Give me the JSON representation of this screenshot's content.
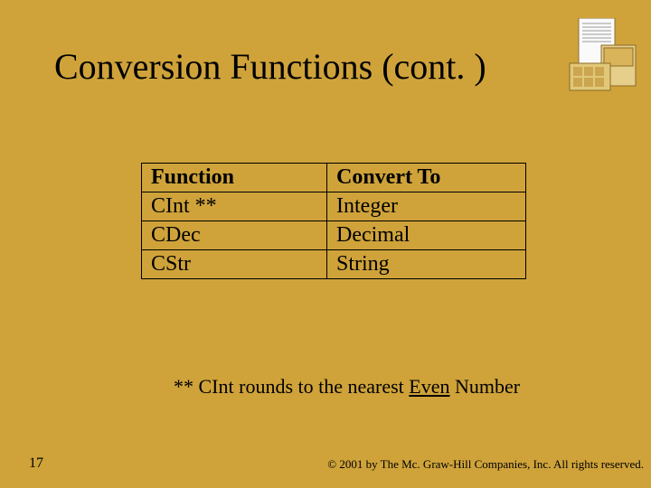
{
  "title": "Conversion Functions (cont. )",
  "table": {
    "headers": {
      "c1": "Function",
      "c2": "Convert To"
    },
    "rows": [
      {
        "c1": "CInt **",
        "c2": "Integer"
      },
      {
        "c1": "CDec",
        "c2": "Decimal"
      },
      {
        "c1": "CStr",
        "c2": "String"
      }
    ]
  },
  "footnote_prefix": "** CInt rounds to the nearest ",
  "footnote_underlined": "Even",
  "footnote_suffix": " Number",
  "page_number": "17",
  "copyright": "© 2001 by The Mc. Graw-Hill Companies, Inc. All rights reserved."
}
